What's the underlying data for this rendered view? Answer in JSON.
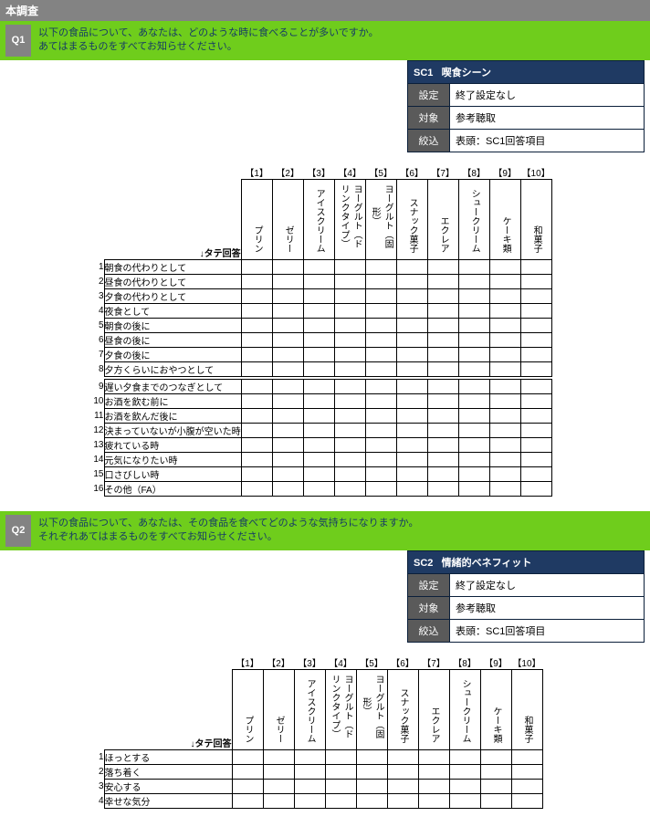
{
  "header": "本調査",
  "columns_idx": [
    "【1】",
    "【2】",
    "【3】",
    "【4】",
    "【5】",
    "【6】",
    "【7】",
    "【8】",
    "【9】",
    "【10】"
  ],
  "columns": [
    "プリン",
    "ゼリー",
    "アイスクリーム",
    "ヨーグルト（ドリンクタイプ）",
    "ヨーグルト（固形）",
    "スナック菓子",
    "エクレア",
    "シュークリーム",
    "ケーキ類",
    "和菓子"
  ],
  "corner_label": "↓タテ回答",
  "q1": {
    "num": "Q1",
    "text1": "以下の食品について、あなたは、どのような時に食べることが多いですか。",
    "text2": "あてはまるものをすべてお知らせください。",
    "sc": {
      "code": "SC1",
      "title": "喫食シーン",
      "rows": [
        {
          "label": "設定",
          "value": "終了設定なし"
        },
        {
          "label": "対象",
          "value": "参考聴取"
        },
        {
          "label": "絞込",
          "value": "表頭：SC1回答項目"
        }
      ]
    },
    "rows": [
      "朝食の代わりとして",
      "昼食の代わりとして",
      "夕食の代わりとして",
      "夜食として",
      "朝食の後に",
      "昼食の後に",
      "夕食の後に",
      "夕方くらいにおやつとして",
      "遅い夕食までのつなぎとして",
      "お酒を飲む前に",
      "お酒を飲んだ後に",
      "決まっていないが小腹が空いた時",
      "疲れている時",
      "元気になりたい時",
      "口さびしい時",
      "その他（FA）"
    ]
  },
  "q2": {
    "num": "Q2",
    "text1": "以下の食品について、あなたは、その食品を食べてどのような気持ちになりますか。",
    "text2": "それぞれあてはまるものをすべてお知らせください。",
    "sc": {
      "code": "SC2",
      "title": "情緒的ベネフィット",
      "rows": [
        {
          "label": "設定",
          "value": "終了設定なし"
        },
        {
          "label": "対象",
          "value": "参考聴取"
        },
        {
          "label": "絞込",
          "value": "表頭：SC1回答項目"
        }
      ]
    },
    "rows": [
      "ほっとする",
      "落ち着く",
      "安心する",
      "幸せな気分"
    ]
  }
}
